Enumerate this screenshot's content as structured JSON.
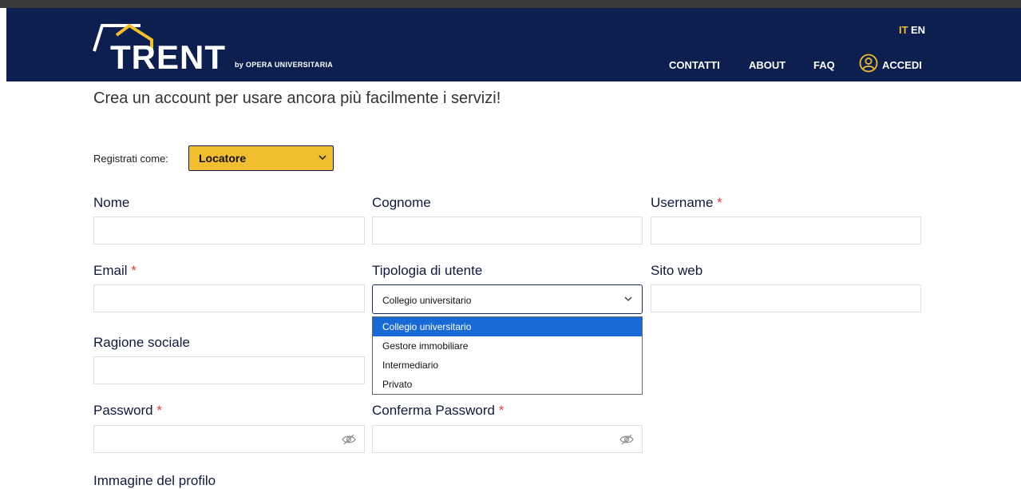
{
  "header": {
    "brand": "TRENT",
    "brand_sub": "by OPERA UNIVERSITARIA",
    "lang_it": "IT",
    "lang_en": "EN",
    "nav": {
      "contatti": "CONTATTI",
      "about": "ABOUT",
      "faq": "FAQ",
      "accedi": "ACCEDI"
    }
  },
  "intro": "Crea un account per usare ancora più facilmente i servizi!",
  "register": {
    "label": "Registrati come:",
    "value": "Locatore"
  },
  "fields": {
    "nome": "Nome",
    "cognome": "Cognome",
    "username": "Username",
    "email": "Email",
    "tipologia": "Tipologia di utente",
    "sito": "Sito web",
    "ragione": "Ragione sociale",
    "password": "Password",
    "conferma": "Conferma Password",
    "immagine": "Immagine del profilo",
    "required_mark": "*"
  },
  "tipologia_select": {
    "value": "Collegio universitario",
    "options": [
      "Collegio universitario",
      "Gestore immobiliare",
      "Intermediario",
      "Privato"
    ]
  },
  "colors": {
    "header_bg": "#0c1f4f",
    "accent": "#f0be2e",
    "selected_option": "#1a6ad6"
  }
}
